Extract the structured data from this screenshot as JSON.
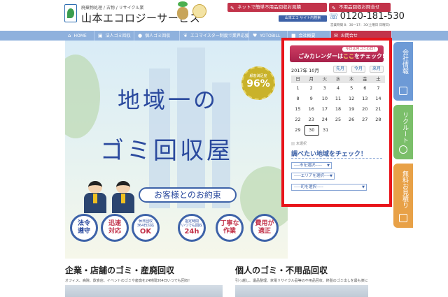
{
  "header": {
    "tagline": "廃棄物処理 / 古物 / リサイクル業",
    "company": "山本エコロジーサービス",
    "net_button": "ネットで簡単不用品回収お見積",
    "inquiry_button": "不用品回収お問合せ",
    "blue_tag": "山本エコ サイト内検索",
    "phone": "0120-181-530",
    "hours": "営業時間 8：30〜17：30(土曜日 日曜日)"
  },
  "nav": {
    "items": [
      {
        "label": "HOME",
        "icon": "home-icon"
      },
      {
        "label": "法人ゴミ回収",
        "icon": "building-icon"
      },
      {
        "label": "個人ゴミ回収",
        "icon": "user-icon"
      },
      {
        "label": "エコマイスター制度で業界応援",
        "icon": "leaf-icon"
      },
      {
        "label": "YOTOBILL",
        "icon": "heart-icon"
      },
      {
        "label": "会社概要",
        "icon": "folder-icon"
      },
      {
        "label": "お問合せ",
        "icon": "mail-icon"
      }
    ]
  },
  "hero": {
    "seal_label": "顧客満足度",
    "seal_value": "96%",
    "title_line1": "地域一の",
    "title_line2": "ゴミ回収屋",
    "promise": "お客様とのお約束",
    "circles": [
      {
        "top": "法令",
        "bottom": "遵守",
        "type": "two"
      },
      {
        "top": "迅速",
        "bottom": "対応",
        "type": "two"
      },
      {
        "top": "休日回収",
        "mid": "364日対応",
        "bottom": "OK",
        "type": "three"
      },
      {
        "top": "指定時間",
        "mid": "いつでも回収",
        "bottom": "24h",
        "type": "three"
      },
      {
        "top": "丁寧な",
        "bottom": "作業",
        "type": "two"
      },
      {
        "top": "費用が",
        "bottom": "適正",
        "type": "two"
      }
    ]
  },
  "calendar": {
    "banner_question": "今日は何ゴミの日?",
    "banner_main_prefix": "ごみカレンダーは",
    "banner_main_highlight": "ここ",
    "banner_main_suffix": "をチェック!!",
    "month_label": "2017年 10月",
    "prev_label": "先月",
    "today_label": "今月",
    "next_label": "来月",
    "weekdays": [
      "日",
      "月",
      "火",
      "水",
      "木",
      "金",
      "土"
    ],
    "weeks": [
      [
        "1",
        "2",
        "3",
        "4",
        "5",
        "6",
        "7"
      ],
      [
        "8",
        "9",
        "10",
        "11",
        "12",
        "13",
        "14"
      ],
      [
        "15",
        "16",
        "17",
        "18",
        "19",
        "20",
        "21"
      ],
      [
        "22",
        "23",
        "24",
        "25",
        "26",
        "27",
        "28"
      ],
      [
        "29",
        "30",
        "31",
        "",
        "",
        "",
        ""
      ]
    ],
    "today": "30",
    "legend": "未選択",
    "check_title": "調べたい地域をチェック！",
    "select_city": "----市を選択-----",
    "select_area": "-----エリアを選択-----",
    "select_town": "-----町を選択-----"
  },
  "side_tabs": {
    "company": "会社情報",
    "recruit": "リクルート",
    "estimate": "無料お見積り"
  },
  "sections": {
    "corporate_title": "企業・店舗のゴミ・産廃回収",
    "corporate_desc": "オフィス、病院、飲食店、イベントのゴミや産廃を24時間364日いつでも回収！",
    "personal_title": "個人のゴミ・不用品回収",
    "personal_desc": "引っ越し、遺品整理、家電リサイクル品等の不用品回収、終盤のゴミ出しを最も楽に！"
  }
}
